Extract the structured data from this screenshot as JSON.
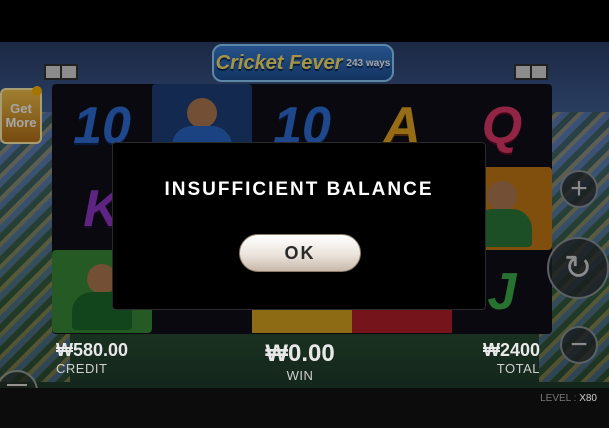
{
  "game": {
    "logo_text": "Cricket Fever",
    "logo_ways": "243 ways",
    "get_more": "Get More"
  },
  "reels": {
    "symbols": [
      {
        "label": "10",
        "color": "blue"
      },
      {
        "label": "",
        "color": "player"
      },
      {
        "label": "10",
        "color": "blue"
      },
      {
        "label": "A",
        "color": "gold"
      },
      {
        "label": "Q",
        "color": "red"
      },
      {
        "label": "K",
        "color": "purple"
      },
      {
        "label": "",
        "color": "blank"
      },
      {
        "label": "",
        "color": "blank"
      },
      {
        "label": "",
        "color": "blank"
      },
      {
        "label": "",
        "color": "player"
      },
      {
        "label": "",
        "color": "player"
      },
      {
        "label": "",
        "color": "blank"
      },
      {
        "label": "",
        "color": "blank"
      },
      {
        "label": "",
        "color": "blank"
      },
      {
        "label": "J",
        "color": "green"
      }
    ]
  },
  "stats": {
    "credit_value": "₩580.00",
    "credit_label": "CREDIT",
    "win_value": "₩0.00",
    "win_label": "WIN",
    "total_value": "₩2400",
    "total_label": "TOTAL"
  },
  "level": {
    "label": "LEVEL :",
    "value": "X80"
  },
  "controls": {
    "plus": "+",
    "minus": "−",
    "spin": "↻"
  },
  "dialog": {
    "message": "INSUFFICIENT BALANCE",
    "ok_label": "OK"
  },
  "colors": {
    "modal_bg": "#000000",
    "ok_button": "#f0e8e0",
    "reel_blue": "#2f6fd6",
    "reel_gold": "#e6a623",
    "reel_red": "#e03a6a"
  }
}
